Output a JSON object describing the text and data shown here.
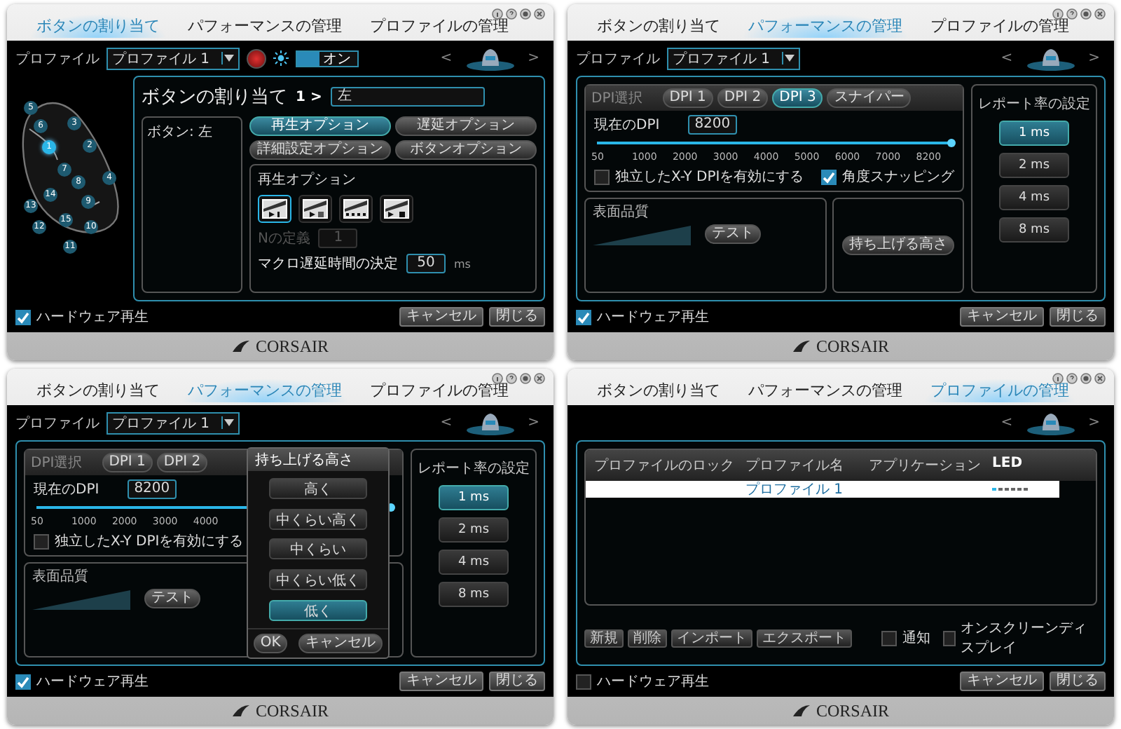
{
  "windows": [
    {
      "kind": "assign",
      "tabs": [
        {
          "label": "ボタンの割り当て",
          "selected": true
        },
        {
          "label": "パフォーマンスの管理",
          "selected": false
        },
        {
          "label": "プロファイルの管理",
          "selected": false
        }
      ],
      "profile": {
        "label": "プロファイル",
        "value": "プロファイル 1"
      },
      "lighting": {
        "on": true,
        "label": "オン"
      },
      "nav": {
        "prev": "<",
        "next": ">"
      },
      "mouse_buttons": [
        {
          "label": "5",
          "selected": false
        },
        {
          "label": "6",
          "selected": false
        },
        {
          "label": "3",
          "selected": false
        },
        {
          "label": "2",
          "selected": false
        },
        {
          "label": "1",
          "selected": true
        },
        {
          "label": "7",
          "selected": false
        },
        {
          "label": "8",
          "selected": false
        },
        {
          "label": "4",
          "selected": false
        },
        {
          "label": "9",
          "selected": false
        },
        {
          "label": "14",
          "selected": false
        },
        {
          "label": "13",
          "selected": false
        },
        {
          "label": "12",
          "selected": false
        },
        {
          "label": "15",
          "selected": false
        },
        {
          "label": "10",
          "selected": false
        },
        {
          "label": "11",
          "selected": false
        }
      ],
      "assign": {
        "title": "ボタンの割り当て",
        "step": "1 >",
        "value": "左",
        "list": [
          "ボタン: 左"
        ],
        "options": [
          {
            "label": "再生オプション",
            "selected": true
          },
          {
            "label": "遅延オプション",
            "selected": false
          },
          {
            "label": "詳細設定オプション",
            "selected": false
          },
          {
            "label": "ボタンオプション",
            "selected": false
          }
        ],
        "panel_title": "再生オプション",
        "modes": [
          {
            "kind": "single",
            "selected": true
          },
          {
            "kind": "count",
            "selected": false
          },
          {
            "kind": "repeat",
            "selected": false
          },
          {
            "kind": "toggle",
            "selected": false
          }
        ],
        "n_label": "Nの定義",
        "n_value": "1",
        "n_disabled": true,
        "delay_label": "マクロ遅延時間の決定",
        "delay_value": "50",
        "delay_unit": "ms"
      },
      "hardware_playback": {
        "label": "ハードウェア再生",
        "checked": true
      },
      "buttons": [
        "キャンセル",
        "閉じる"
      ],
      "logo": "CORSAIR"
    },
    {
      "kind": "performance",
      "tabs": [
        {
          "label": "ボタンの割り当て",
          "selected": false
        },
        {
          "label": "パフォーマンスの管理",
          "selected": true
        },
        {
          "label": "プロファイルの管理",
          "selected": false
        }
      ],
      "profile": {
        "label": "プロファイル",
        "value": "プロファイル 1"
      },
      "nav": {
        "prev": "<",
        "next": ">"
      },
      "performance": {
        "dpi_label": "DPI選択",
        "dpi_buttons": [
          {
            "label": "DPI 1",
            "selected": false
          },
          {
            "label": "DPI 2",
            "selected": false
          },
          {
            "label": "DPI 3",
            "selected": true
          },
          {
            "label": "スナイパー",
            "selected": false
          }
        ],
        "current_label": "現在のDPI",
        "current_value": "8200",
        "slider": {
          "level": 1
        },
        "ticks": [
          "50",
          "1000",
          "2000",
          "3000",
          "4000",
          "5000",
          "6000",
          "7000",
          "8200"
        ],
        "checks": [
          {
            "label": "独立したX-Y DPIを有効にする",
            "checked": false
          },
          {
            "label": "角度スナッピング",
            "checked": true
          }
        ],
        "surface_label": "表面品質",
        "test_button": "テスト",
        "lift_button": "持ち上げる高さ",
        "rate_title": "レポート率の設定",
        "rates": [
          {
            "label": "1 ms",
            "selected": true
          },
          {
            "label": "2 ms",
            "selected": false
          },
          {
            "label": "4 ms",
            "selected": false
          },
          {
            "label": "8 ms",
            "selected": false
          }
        ]
      },
      "hardware_playback": {
        "label": "ハードウェア再生",
        "checked": true
      },
      "buttons": [
        "キャンセル",
        "閉じる"
      ],
      "logo": "CORSAIR"
    },
    {
      "kind": "performance",
      "tabs": [
        {
          "label": "ボタンの割り当て",
          "selected": false
        },
        {
          "label": "パフォーマンスの管理",
          "selected": true
        },
        {
          "label": "プロファイルの管理",
          "selected": false
        }
      ],
      "profile": {
        "label": "プロファイル",
        "value": "プロファイル 1"
      },
      "nav": {
        "prev": "<",
        "next": ">"
      },
      "performance": {
        "dpi_label": "DPI選択",
        "dpi_buttons": [
          {
            "label": "DPI 1",
            "selected": false
          },
          {
            "label": "DPI 2",
            "selected": false
          }
        ],
        "current_label": "現在のDPI",
        "current_value": "8200",
        "slider": {
          "level": 1
        },
        "ticks": [
          "50",
          "1000",
          "2000",
          "3000",
          "4000"
        ],
        "checks": [
          {
            "label": "独立したX-Y DPIを有効にする",
            "checked": false
          }
        ],
        "surface_label": "表面品質",
        "test_button": "テスト",
        "rate_title": "レポート率の設定",
        "rates": [
          {
            "label": "1 ms",
            "selected": true
          },
          {
            "label": "2 ms",
            "selected": false
          },
          {
            "label": "4 ms",
            "selected": false
          },
          {
            "label": "8 ms",
            "selected": false
          }
        ]
      },
      "dialog": {
        "title": "持ち上げる高さ",
        "options": [
          {
            "label": "高く",
            "selected": false
          },
          {
            "label": "中くらい高く",
            "selected": false
          },
          {
            "label": "中くらい",
            "selected": false
          },
          {
            "label": "中くらい低く",
            "selected": false
          },
          {
            "label": "低く",
            "selected": true
          }
        ],
        "ok": "OK",
        "cancel": "キャンセル"
      },
      "hardware_playback": {
        "label": "ハードウェア再生",
        "checked": true
      },
      "buttons": [
        "キャンセル",
        "閉じる"
      ],
      "logo": "CORSAIR"
    },
    {
      "kind": "profiles",
      "tabs": [
        {
          "label": "ボタンの割り当て",
          "selected": false
        },
        {
          "label": "パフォーマンスの管理",
          "selected": false
        },
        {
          "label": "プロファイルの管理",
          "selected": true
        }
      ],
      "nav": {
        "prev": "<",
        "next": ">"
      },
      "profiles": {
        "columns": [
          "プロファイルのロック",
          "プロファイル名",
          "アプリケーション",
          "LED"
        ],
        "rows": [
          {
            "name": "プロファイル 1",
            "selected": true
          }
        ],
        "actions": [
          "新規",
          "削除",
          "インポート",
          "エクスポート"
        ],
        "checks": [
          {
            "label": "通知",
            "checked": false
          },
          {
            "label": "オンスクリーンディスプレイ",
            "checked": false
          }
        ]
      },
      "hardware_playback": {
        "label": "ハードウェア再生",
        "checked": false
      },
      "buttons": [
        "キャンセル",
        "閉じる"
      ],
      "logo": "CORSAIR"
    }
  ]
}
